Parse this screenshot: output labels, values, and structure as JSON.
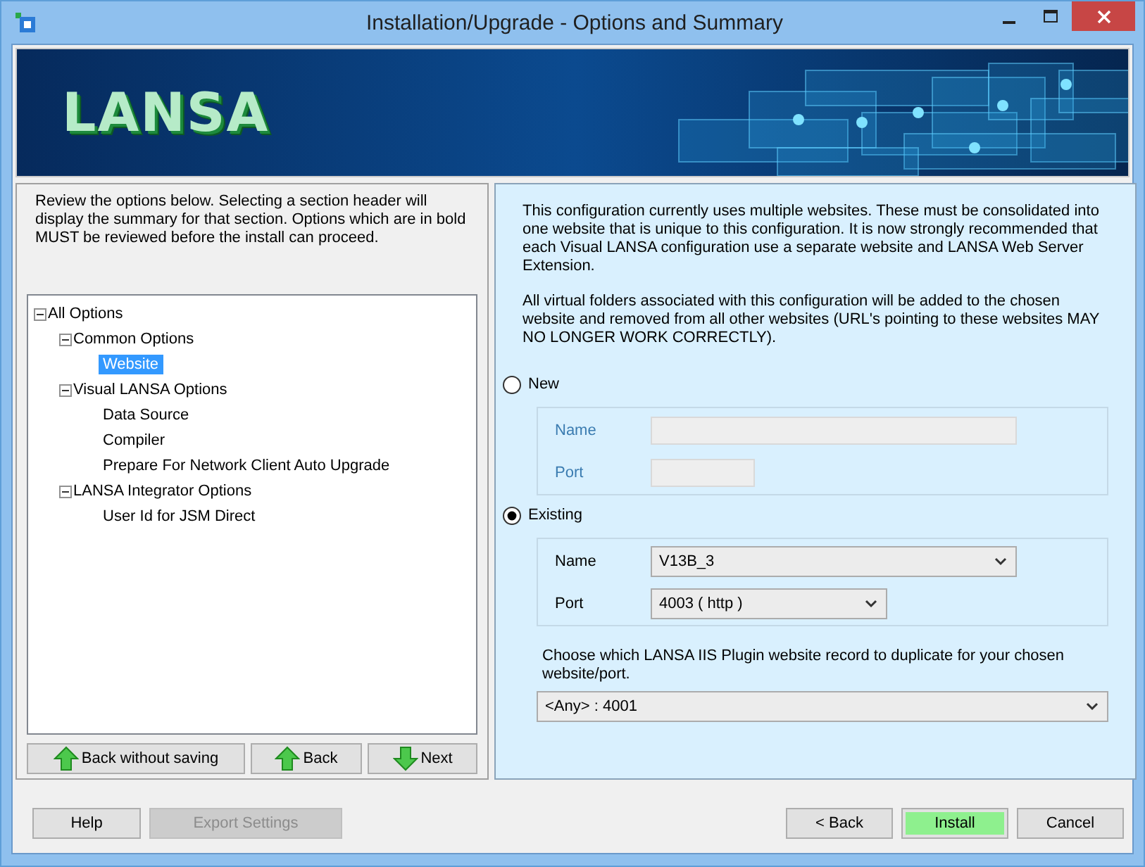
{
  "window": {
    "title": "Installation/Upgrade - Options and Summary"
  },
  "banner": {
    "logo": "LANSA"
  },
  "left_panel": {
    "instructions": "Review the options below. Selecting a section header will display the summary for that section. Options which are in bold MUST be reviewed before the install can proceed.",
    "tree": [
      {
        "label": "All Options",
        "expanded": true,
        "selected": false,
        "children": [
          {
            "label": "Common Options",
            "expanded": true,
            "selected": false,
            "children": [
              {
                "label": "Website",
                "selected": true
              }
            ]
          },
          {
            "label": "Visual LANSA Options",
            "expanded": true,
            "selected": false,
            "children": [
              {
                "label": "Data Source",
                "selected": false
              },
              {
                "label": "Compiler",
                "selected": false
              },
              {
                "label": "Prepare For Network Client Auto Upgrade",
                "selected": false
              }
            ]
          },
          {
            "label": "LANSA Integrator Options",
            "expanded": true,
            "selected": false,
            "children": [
              {
                "label": "User Id for JSM Direct",
                "selected": false
              }
            ]
          }
        ]
      }
    ],
    "nav_buttons": [
      {
        "label": "Back without saving",
        "kind": "up"
      },
      {
        "label": "Back",
        "kind": "up"
      },
      {
        "label": "Next",
        "kind": "down"
      }
    ]
  },
  "right_panel": {
    "paragraphs": [
      "This configuration currently uses multiple websites. These must be consolidated into one website that is unique to this configuration. It is now strongly recommended that each Visual LANSA configuration use a separate website and LANSA Web Server Extension.",
      "All virtual folders associated with this configuration will be added to the chosen website and removed from all other websites (URL's pointing to these websites MAY NO LONGER WORK CORRECTLY)."
    ],
    "options": [
      {
        "label": "New",
        "selected": false,
        "fields": [
          {
            "label": "Name",
            "kind": "text"
          },
          {
            "label": "Port",
            "kind": "text"
          }
        ]
      },
      {
        "label": "Existing",
        "selected": true,
        "fields": [
          {
            "label": "Name",
            "kind": "dropdown",
            "value": "V13B_3"
          },
          {
            "label": "Port",
            "kind": "dropdown",
            "value": "4003 ( http )"
          }
        ]
      }
    ],
    "plugin": {
      "prompt": "Choose which LANSA IIS Plugin website record to duplicate for your chosen website/port.",
      "value": "<Any> : 4001"
    }
  },
  "footer": {
    "left_buttons": [
      {
        "label": "Help",
        "disabled": false,
        "primary": false
      },
      {
        "label": "Export Settings",
        "disabled": true,
        "primary": false
      }
    ],
    "right_buttons": [
      {
        "label": "< Back",
        "disabled": false,
        "primary": false
      },
      {
        "label": "Install",
        "disabled": false,
        "primary": true
      },
      {
        "label": "Cancel",
        "disabled": false,
        "primary": false
      }
    ]
  }
}
